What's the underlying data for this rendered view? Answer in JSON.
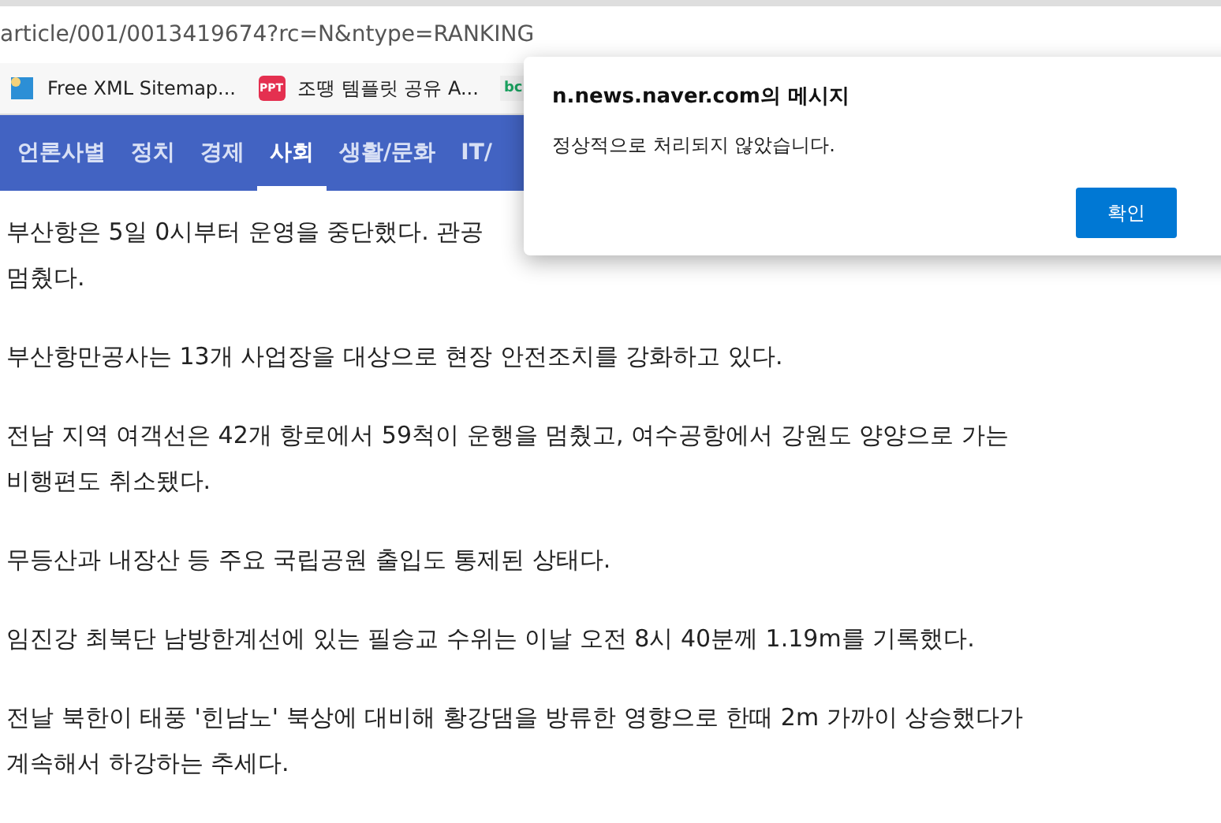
{
  "address_bar": {
    "url": "article/001/0013419674?rc=N&ntype=RANKING"
  },
  "bookmarks": [
    {
      "kind": "sitemap",
      "label": "Free XML Sitemap..."
    },
    {
      "kind": "badge",
      "icon_text": "PPT",
      "label": "조땡 템플릿 공유 A..."
    },
    {
      "kind": "tile",
      "icon_text": "bc"
    }
  ],
  "nav": [
    {
      "label": "언론사별",
      "selected": false
    },
    {
      "label": "정치",
      "selected": false
    },
    {
      "label": "경제",
      "selected": false
    },
    {
      "label": "사회",
      "selected": true
    },
    {
      "label": "생활/문화",
      "selected": false
    },
    {
      "label": "IT/",
      "selected": false
    }
  ],
  "article": [
    [
      "부산항은 5일 0시부터 운영을 중단했다. 관공",
      "멈췄다."
    ],
    [
      "부산항만공사는 13개 사업장을 대상으로 현장 안전조치를 강화하고 있다."
    ],
    [
      "전남 지역 여객선은 42개 항로에서 59척이 운행을 멈췄고, 여수공항에서 강원도 양양으로 가는",
      "비행편도 취소됐다."
    ],
    [
      "무등산과 내장산 등 주요 국립공원 출입도 통제된 상태다."
    ],
    [
      "임진강 최북단 남방한계선에 있는 필승교 수위는 이날 오전 8시 40분께 1.19m를 기록했다."
    ],
    [
      "전날 북한이 태풍 '힌남노' 북상에 대비해 황강댐을 방류한 영향으로 한때 2m 가까이 상승했다가",
      "계속해서 하강하는 추세다."
    ]
  ],
  "dialog": {
    "title": "n.news.naver.com의 메시지",
    "message": "정상적으로 처리되지 않았습니다.",
    "button": "확인"
  }
}
